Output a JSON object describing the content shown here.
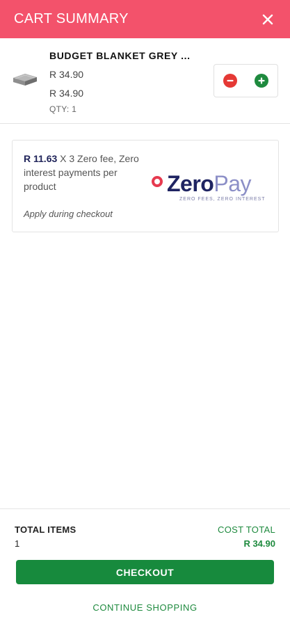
{
  "header": {
    "title": "CART SUMMARY",
    "close_icon": "close-icon"
  },
  "cart_item": {
    "name": "BUDGET BLANKET GREY ...",
    "price": "R 34.90",
    "subtotal": "R 34.90",
    "qty_text": "QTY: 1",
    "image_icon": "blanket-product-image",
    "minus_icon": "minus-icon",
    "plus_icon": "plus-icon"
  },
  "zeropay": {
    "amount": "R 11.63",
    "description": " X 3 Zero fee, Zero interest payments per product",
    "note": "Apply during checkout",
    "logo_zero": "Zero",
    "logo_pay": "Pay",
    "logo_tagline": "ZERO FEES, ZERO INTEREST"
  },
  "footer": {
    "total_items_label": "TOTAL ITEMS",
    "total_items_value": "1",
    "cost_total_label": "COST TOTAL",
    "cost_total_value": "R 34.90",
    "checkout_label": "CHECKOUT",
    "continue_label": "CONTINUE SHOPPING"
  },
  "colors": {
    "header_bg": "#f3526b",
    "accent_green": "#178a3d",
    "minus_red": "#e53935",
    "zeropay_navy": "#1f2462",
    "zeropay_lavender": "#8c8fc7",
    "zeropay_red": "#e63a4f"
  }
}
